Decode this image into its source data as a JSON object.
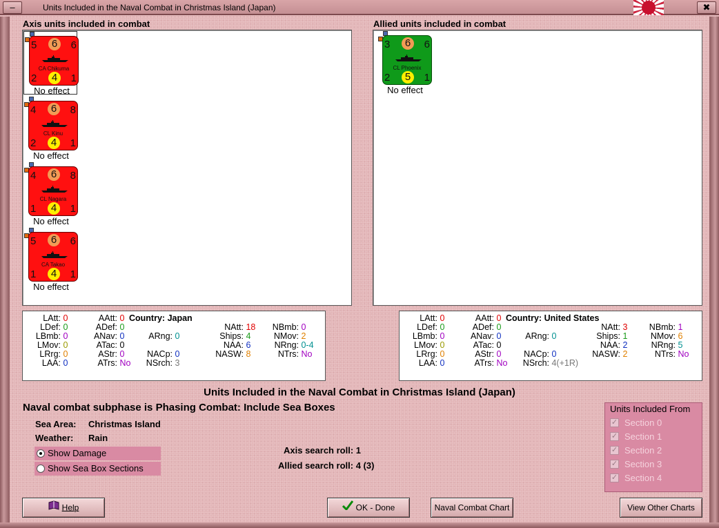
{
  "window": {
    "title": "Units Included in the Naval Combat in Christmas Island (Japan)",
    "min_label": "–",
    "close_label": "✖"
  },
  "axis": {
    "heading": "Axis units included in combat",
    "units": [
      {
        "name": "CA Chikuma",
        "tl": "5",
        "top": "6",
        "tr": "6",
        "bl": "2",
        "bot": "4",
        "br": "1",
        "effect": "No effect"
      },
      {
        "name": "CL Kinu",
        "tl": "4",
        "top": "6",
        "tr": "8",
        "bl": "2",
        "bot": "4",
        "br": "1",
        "effect": "No effect"
      },
      {
        "name": "CL Nagara",
        "tl": "4",
        "top": "6",
        "tr": "8",
        "bl": "1",
        "bot": "4",
        "br": "1",
        "effect": "No effect"
      },
      {
        "name": "CA Takao",
        "tl": "5",
        "top": "6",
        "tr": "6",
        "bl": "1",
        "bot": "4",
        "br": "1",
        "effect": "No effect"
      }
    ],
    "stats": {
      "country_label": "Country:",
      "country": "Japan",
      "LAtt": "0",
      "LDef": "0",
      "LBmb": "0",
      "LMov": "0",
      "LRrg": "0",
      "LAA": "0",
      "AAtt": "0",
      "ADef": "0",
      "ANav": "0",
      "ATac": "0",
      "AStr": "0",
      "ATrs": "No",
      "ARng": "0",
      "NACp": "0",
      "NSrch": "3",
      "NAtt": "18",
      "Ships": "4",
      "NAA": "6",
      "NASW": "8",
      "NBmb": "0",
      "NMov": "2",
      "NRng": "0-4",
      "NTrs": "No"
    }
  },
  "allied": {
    "heading": "Allied units included in combat",
    "units": [
      {
        "name": "CL Phoenix",
        "tl": "3",
        "top": "6",
        "tr": "6",
        "bl": "2",
        "bot": "5",
        "br": "1",
        "effect": "No effect"
      }
    ],
    "stats": {
      "country_label": "Country:",
      "country": "United States",
      "LAtt": "0",
      "LDef": "0",
      "LBmb": "0",
      "LMov": "0",
      "LRrg": "0",
      "LAA": "0",
      "AAtt": "0",
      "ADef": "0",
      "ANav": "0",
      "ATac": "0",
      "AStr": "0",
      "ATrs": "No",
      "ARng": "0",
      "NACp": "0",
      "NSrch": "4(+1R)",
      "NAtt": "3",
      "Ships": "1",
      "NAA": "2",
      "NASW": "2",
      "NBmb": "1",
      "NMov": "6",
      "NRng": "5",
      "NTrs": "No"
    }
  },
  "summary": {
    "title": "Units Included in the Naval Combat in Christmas Island (Japan)",
    "subphase": "Naval combat subphase is Phasing Combat: Include Sea Boxes",
    "sea_area_label": "Sea Area:",
    "sea_area": "Christmas Island",
    "weather_label": "Weather:",
    "weather": "Rain",
    "axis_roll": "Axis search roll: 1",
    "allied_roll": "Allied search roll: 4 (3)",
    "show_damage": "Show Damage",
    "show_sections": "Show Sea Box Sections"
  },
  "sections": {
    "title": "Units Included From",
    "items": [
      "Section 0",
      "Section 1",
      "Section 2",
      "Section 3",
      "Section 4"
    ]
  },
  "buttons": {
    "help": "Help",
    "ok": "OK - Done",
    "naval_chart": "Naval Combat Chart",
    "other_charts": "View Other Charts"
  },
  "colors": {
    "axis_counter": "#ff1010",
    "allied_counter": "#0f9a1a",
    "zero": "#e00000",
    "green": "#1a9a1a",
    "purple": "#a000c0",
    "blue": "#1030c0",
    "teal": "#009090",
    "orange": "#e08000",
    "olive": "#9a9a00",
    "gray": "#777777"
  }
}
